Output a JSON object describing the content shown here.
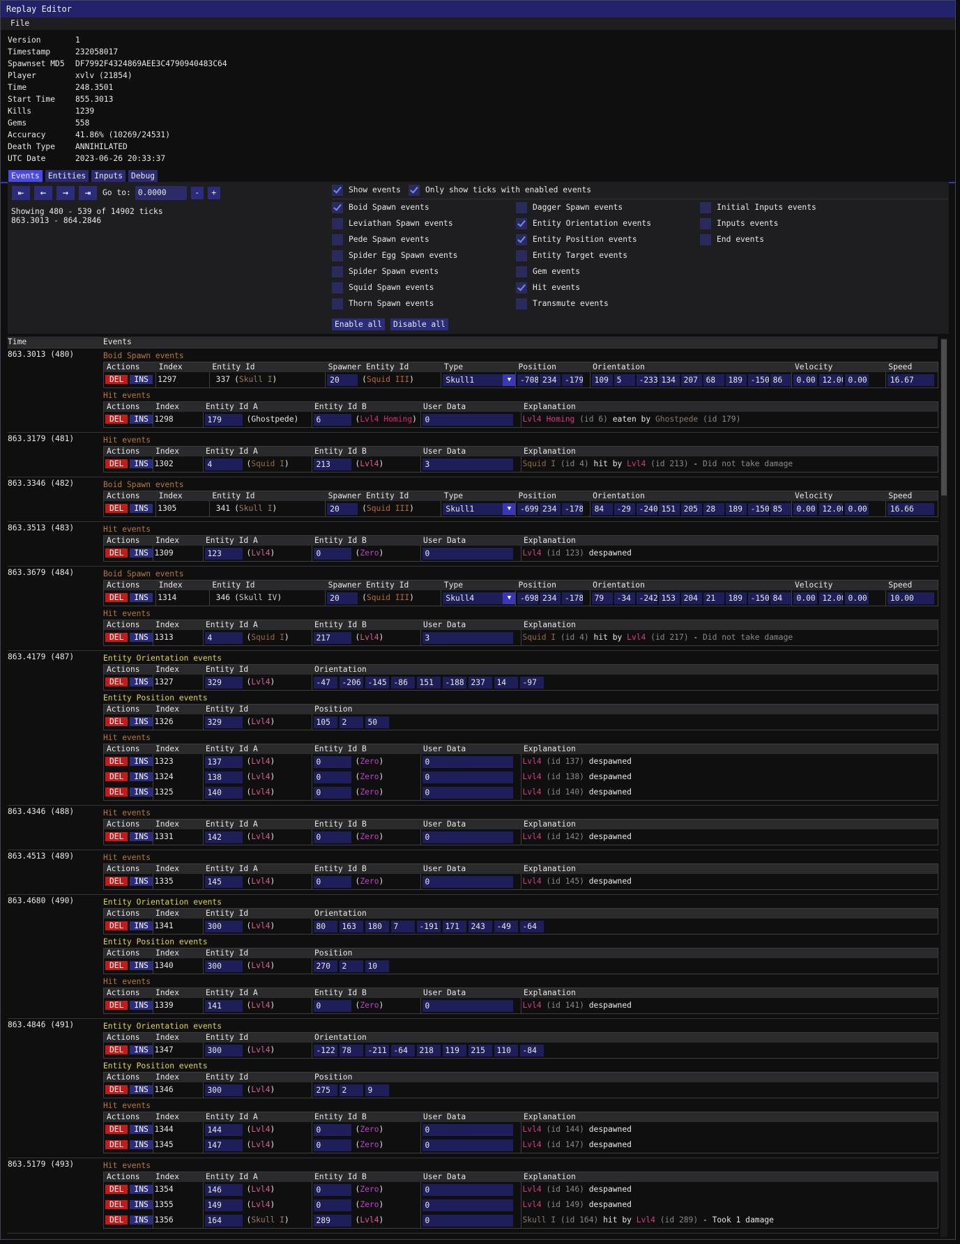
{
  "window": {
    "title": "Replay Editor"
  },
  "menu": {
    "file": "File"
  },
  "meta": [
    {
      "k": "Version",
      "v": "1"
    },
    {
      "k": "Timestamp",
      "v": "232058017"
    },
    {
      "k": "Spawnset MD5",
      "v": "DF7992F4324869AEE3C4790940483C64"
    },
    {
      "k": "Player",
      "v": "xvlv (21854)"
    },
    {
      "k": "Time",
      "v": "248.3501"
    },
    {
      "k": "Start Time",
      "v": "855.3013"
    },
    {
      "k": "Kills",
      "v": "1239"
    },
    {
      "k": "Gems",
      "v": "558"
    },
    {
      "k": "Accuracy",
      "v": "41.86% (10269/24531)"
    },
    {
      "k": "Death Type",
      "v": "ANNIHILATED"
    },
    {
      "k": "UTC Date",
      "v": "2023-06-26 20:33:37"
    }
  ],
  "tabs": [
    "Events",
    "Entities",
    "Inputs",
    "Debug"
  ],
  "nav": {
    "goto_label": "Go to:",
    "goto_value": "0.0000",
    "minus": "-",
    "plus": "+",
    "showing": "Showing 480 - 539 of 14902 ticks",
    "range": "863.3013 - 864.2846"
  },
  "filters": {
    "show_events": {
      "label": "Show events",
      "checked": true
    },
    "only_enabled": {
      "label": "Only show ticks with enabled events",
      "checked": true
    },
    "col1": [
      {
        "label": "Boid Spawn events",
        "checked": true
      },
      {
        "label": "Leviathan Spawn events",
        "checked": false
      },
      {
        "label": "Pede Spawn events",
        "checked": false
      },
      {
        "label": "Spider Egg Spawn events",
        "checked": false
      },
      {
        "label": "Spider Spawn events",
        "checked": false
      },
      {
        "label": "Squid Spawn events",
        "checked": false
      },
      {
        "label": "Thorn Spawn events",
        "checked": false
      }
    ],
    "col2": [
      {
        "label": "Dagger Spawn events",
        "checked": false
      },
      {
        "label": "Entity Orientation events",
        "checked": true
      },
      {
        "label": "Entity Position events",
        "checked": true
      },
      {
        "label": "Entity Target events",
        "checked": false
      },
      {
        "label": "Gem events",
        "checked": false
      },
      {
        "label": "Hit events",
        "checked": true
      },
      {
        "label": "Transmute events",
        "checked": false
      }
    ],
    "col3": [
      {
        "label": "Initial Inputs events",
        "checked": false
      },
      {
        "label": "Inputs events",
        "checked": false
      },
      {
        "label": "End events",
        "checked": false
      }
    ],
    "enable_all": "Enable all",
    "disable_all": "Disable all"
  },
  "header": {
    "time": "Time",
    "events": "Events"
  },
  "labels": {
    "del": "DEL",
    "ins": "INS",
    "actions": "Actions",
    "index": "Index",
    "entity_id": "Entity Id",
    "spawner_entity_id": "Spawner Entity Id",
    "type": "Type",
    "position": "Position",
    "orientation": "Orientation",
    "velocity": "Velocity",
    "speed": "Speed",
    "entity_id_a": "Entity Id A",
    "entity_id_b": "Entity Id B",
    "user_data": "User Data",
    "explanation": "Explanation",
    "boid": "Boid Spawn events",
    "hit": "Hit events",
    "orient": "Entity Orientation events",
    "pos": "Entity Position events"
  },
  "ticks": [
    {
      "time": "863.3013 (480)",
      "groups": [
        {
          "kind": "boid",
          "rows": [
            {
              "index": "1297",
              "eid": "337",
              "eref": "Skull I",
              "sid": "20",
              "sref": "Squid III",
              "type": "Skull1",
              "pos": [
                "-708",
                "234",
                "-179"
              ],
              "orient": [
                "109",
                "5",
                "-233",
                "134",
                "207",
                "68",
                "189",
                "-150",
                "86"
              ],
              "vel": [
                "0.00",
                "12.00",
                "0.00"
              ],
              "speed": "16.67"
            }
          ]
        },
        {
          "kind": "hit",
          "rows": [
            {
              "index": "1298",
              "a": "179",
              "aref": "Ghostpede",
              "acls": "ghost",
              "b": "6",
              "bref": "Lvl4 Homing",
              "bcls": "pink",
              "ud": "0",
              "expl": [
                [
                  "Lvl4 Homing",
                  "pink"
                ],
                [
                  " (id 6) ",
                  "dim"
                ],
                [
                  "eaten by ",
                  ""
                ],
                [
                  "Ghostpede",
                  "skull"
                ],
                [
                  " (id 179)",
                  "dim"
                ]
              ]
            }
          ]
        }
      ]
    },
    {
      "time": "863.3179 (481)",
      "groups": [
        {
          "kind": "hit",
          "rows": [
            {
              "index": "1302",
              "a": "4",
              "aref": "Squid I",
              "acls": "squid1",
              "b": "213",
              "bref": "Lvl4",
              "bcls": "",
              "ud": "3",
              "expl": [
                [
                  "Squid I",
                  "squid1"
                ],
                [
                  " (id 4) ",
                  "dim"
                ],
                [
                  "hit by ",
                  ""
                ],
                [
                  "Lvl4",
                  "pink"
                ],
                [
                  " (id 213) ",
                  "dim"
                ],
                [
                  "- ",
                  ""
                ],
                [
                  "Did not take damage",
                  "dim"
                ]
              ]
            }
          ]
        }
      ]
    },
    {
      "time": "863.3346 (482)",
      "groups": [
        {
          "kind": "boid",
          "rows": [
            {
              "index": "1305",
              "eid": "341",
              "eref": "Skull I",
              "sid": "20",
              "sref": "Squid III",
              "type": "Skull1",
              "pos": [
                "-699",
                "234",
                "-178"
              ],
              "orient": [
                "84",
                "-29",
                "-240",
                "151",
                "205",
                "28",
                "189",
                "-150",
                "85"
              ],
              "vel": [
                "0.00",
                "12.00",
                "0.00"
              ],
              "speed": "16.66"
            }
          ]
        }
      ]
    },
    {
      "time": "863.3513 (483)",
      "groups": [
        {
          "kind": "hit",
          "rows": [
            {
              "index": "1309",
              "a": "123",
              "aref": "Lvl4",
              "acls": "",
              "b": "0",
              "bref": "Zero",
              "bcls": "zero",
              "ud": "0",
              "expl": [
                [
                  "Lvl4",
                  "pink"
                ],
                [
                  " (id 123) ",
                  "dim"
                ],
                [
                  "despawned",
                  ""
                ]
              ]
            }
          ]
        }
      ]
    },
    {
      "time": "863.3679 (484)",
      "groups": [
        {
          "kind": "boid",
          "rows": [
            {
              "index": "1314",
              "eid": "346",
              "eref": "Skull IV",
              "sid": "20",
              "sref": "Squid III",
              "type": "Skull4",
              "pos": [
                "-698",
                "234",
                "-178"
              ],
              "orient": [
                "79",
                "-34",
                "-242",
                "153",
                "204",
                "21",
                "189",
                "-150",
                "84"
              ],
              "vel": [
                "0.00",
                "12.00",
                "0.00"
              ],
              "speed": "10.00"
            }
          ]
        },
        {
          "kind": "hit",
          "rows": [
            {
              "index": "1313",
              "a": "4",
              "aref": "Squid I",
              "acls": "squid1",
              "b": "217",
              "bref": "Lvl4",
              "bcls": "",
              "ud": "3",
              "expl": [
                [
                  "Squid I",
                  "squid1"
                ],
                [
                  " (id 4) ",
                  "dim"
                ],
                [
                  "hit by ",
                  ""
                ],
                [
                  "Lvl4",
                  "pink"
                ],
                [
                  " (id 217) ",
                  "dim"
                ],
                [
                  "- ",
                  ""
                ],
                [
                  "Did not take damage",
                  "dim"
                ]
              ]
            }
          ]
        }
      ]
    },
    {
      "time": "863.4179 (487)",
      "groups": [
        {
          "kind": "orient",
          "rows": [
            {
              "index": "1327",
              "eid": "329",
              "eref": "Lvl4",
              "orient": [
                "-47",
                "-206",
                "-145",
                "-86",
                "151",
                "-188",
                "237",
                "14",
                "-97"
              ]
            }
          ]
        },
        {
          "kind": "pos",
          "rows": [
            {
              "index": "1326",
              "eid": "329",
              "eref": "Lvl4",
              "pos": [
                "105",
                "2",
                "50"
              ]
            }
          ]
        },
        {
          "kind": "hit",
          "rows": [
            {
              "index": "1323",
              "a": "137",
              "aref": "Lvl4",
              "acls": "",
              "b": "0",
              "bref": "Zero",
              "bcls": "zero",
              "ud": "0",
              "expl": [
                [
                  "Lvl4",
                  "pink"
                ],
                [
                  " (id 137) ",
                  "dim"
                ],
                [
                  "despawned",
                  ""
                ]
              ]
            },
            {
              "index": "1324",
              "a": "138",
              "aref": "Lvl4",
              "acls": "",
              "b": "0",
              "bref": "Zero",
              "bcls": "zero",
              "ud": "0",
              "expl": [
                [
                  "Lvl4",
                  "pink"
                ],
                [
                  " (id 138) ",
                  "dim"
                ],
                [
                  "despawned",
                  ""
                ]
              ]
            },
            {
              "index": "1325",
              "a": "140",
              "aref": "Lvl4",
              "acls": "",
              "b": "0",
              "bref": "Zero",
              "bcls": "zero",
              "ud": "0",
              "expl": [
                [
                  "Lvl4",
                  "pink"
                ],
                [
                  " (id 140) ",
                  "dim"
                ],
                [
                  "despawned",
                  ""
                ]
              ]
            }
          ]
        }
      ]
    },
    {
      "time": "863.4346 (488)",
      "groups": [
        {
          "kind": "hit",
          "rows": [
            {
              "index": "1331",
              "a": "142",
              "aref": "Lvl4",
              "acls": "",
              "b": "0",
              "bref": "Zero",
              "bcls": "zero",
              "ud": "0",
              "expl": [
                [
                  "Lvl4",
                  "pink"
                ],
                [
                  " (id 142) ",
                  "dim"
                ],
                [
                  "despawned",
                  ""
                ]
              ]
            }
          ]
        }
      ]
    },
    {
      "time": "863.4513 (489)",
      "groups": [
        {
          "kind": "hit",
          "rows": [
            {
              "index": "1335",
              "a": "145",
              "aref": "Lvl4",
              "acls": "",
              "b": "0",
              "bref": "Zero",
              "bcls": "zero",
              "ud": "0",
              "expl": [
                [
                  "Lvl4",
                  "pink"
                ],
                [
                  " (id 145) ",
                  "dim"
                ],
                [
                  "despawned",
                  ""
                ]
              ]
            }
          ]
        }
      ]
    },
    {
      "time": "863.4680 (490)",
      "groups": [
        {
          "kind": "orient",
          "rows": [
            {
              "index": "1341",
              "eid": "300",
              "eref": "Lvl4",
              "orient": [
                "80",
                "163",
                "180",
                "7",
                "-191",
                "171",
                "243",
                "-49",
                "-64"
              ]
            }
          ]
        },
        {
          "kind": "pos",
          "rows": [
            {
              "index": "1340",
              "eid": "300",
              "eref": "Lvl4",
              "pos": [
                "270",
                "2",
                "10"
              ]
            }
          ]
        },
        {
          "kind": "hit",
          "rows": [
            {
              "index": "1339",
              "a": "141",
              "aref": "Lvl4",
              "acls": "",
              "b": "0",
              "bref": "Zero",
              "bcls": "zero",
              "ud": "0",
              "expl": [
                [
                  "Lvl4",
                  "pink"
                ],
                [
                  " (id 141) ",
                  "dim"
                ],
                [
                  "despawned",
                  ""
                ]
              ]
            }
          ]
        }
      ]
    },
    {
      "time": "863.4846 (491)",
      "groups": [
        {
          "kind": "orient",
          "rows": [
            {
              "index": "1347",
              "eid": "300",
              "eref": "Lvl4",
              "orient": [
                "-122",
                "78",
                "-211",
                "-64",
                "218",
                "119",
                "215",
                "110",
                "-84"
              ]
            }
          ]
        },
        {
          "kind": "pos",
          "rows": [
            {
              "index": "1346",
              "eid": "300",
              "eref": "Lvl4",
              "pos": [
                "275",
                "2",
                "9"
              ]
            }
          ]
        },
        {
          "kind": "hit",
          "rows": [
            {
              "index": "1344",
              "a": "144",
              "aref": "Lvl4",
              "acls": "",
              "b": "0",
              "bref": "Zero",
              "bcls": "zero",
              "ud": "0",
              "expl": [
                [
                  "Lvl4",
                  "pink"
                ],
                [
                  " (id 144) ",
                  "dim"
                ],
                [
                  "despawned",
                  ""
                ]
              ]
            },
            {
              "index": "1345",
              "a": "147",
              "aref": "Lvl4",
              "acls": "",
              "b": "0",
              "bref": "Zero",
              "bcls": "zero",
              "ud": "0",
              "expl": [
                [
                  "Lvl4",
                  "pink"
                ],
                [
                  " (id 147) ",
                  "dim"
                ],
                [
                  "despawned",
                  ""
                ]
              ]
            }
          ]
        }
      ]
    },
    {
      "time": "863.5179 (493)",
      "groups": [
        {
          "kind": "hit",
          "rows": [
            {
              "index": "1354",
              "a": "146",
              "aref": "Lvl4",
              "acls": "",
              "b": "0",
              "bref": "Zero",
              "bcls": "zero",
              "ud": "0",
              "expl": [
                [
                  "Lvl4",
                  "pink"
                ],
                [
                  " (id 146) ",
                  "dim"
                ],
                [
                  "despawned",
                  ""
                ]
              ]
            },
            {
              "index": "1355",
              "a": "149",
              "aref": "Lvl4",
              "acls": "",
              "b": "0",
              "bref": "Zero",
              "bcls": "zero",
              "ud": "0",
              "expl": [
                [
                  "Lvl4",
                  "pink"
                ],
                [
                  " (id 149) ",
                  "dim"
                ],
                [
                  "despawned",
                  ""
                ]
              ]
            },
            {
              "index": "1356",
              "a": "164",
              "aref": "Skull I",
              "acls": "skull",
              "b": "289",
              "bref": "Lvl4",
              "bcls": "",
              "ud": "0",
              "expl": [
                [
                  "Skull I",
                  "skull"
                ],
                [
                  " (id 164) ",
                  "dim"
                ],
                [
                  "hit by ",
                  ""
                ],
                [
                  "Lvl4",
                  "pink"
                ],
                [
                  " (id 289) ",
                  "dim"
                ],
                [
                  "- Took 1 damage",
                  ""
                ]
              ]
            }
          ]
        }
      ]
    }
  ]
}
